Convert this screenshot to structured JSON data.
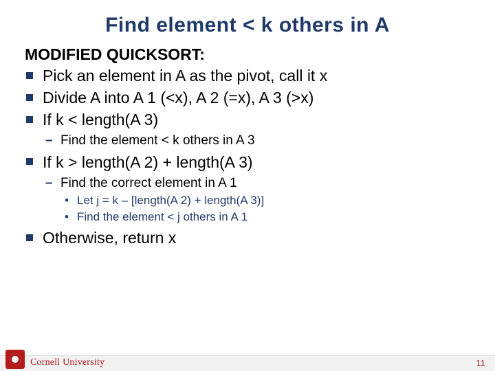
{
  "title": "Find element < k others in A",
  "heading": "MODIFIED QUICKSORT:",
  "bullets": [
    {
      "text": "Pick an element in A as the pivot, call it x"
    },
    {
      "text": "Divide A into A 1 (<x), A 2 (=x), A 3 (>x)"
    },
    {
      "text": "If k < length(A 3)",
      "children": [
        {
          "text": "Find the element < k others in A 3"
        }
      ]
    },
    {
      "text": "If k > length(A 2) + length(A 3)",
      "children": [
        {
          "text": "Find the correct element in A 1",
          "children": [
            {
              "text": "Let j = k – [length(A 2) + length(A 3)]"
            },
            {
              "text": "Find the element < j others in A 1"
            }
          ]
        }
      ]
    },
    {
      "text": "Otherwise, return x"
    }
  ],
  "footer": {
    "university": "Cornell University",
    "page": "11"
  }
}
